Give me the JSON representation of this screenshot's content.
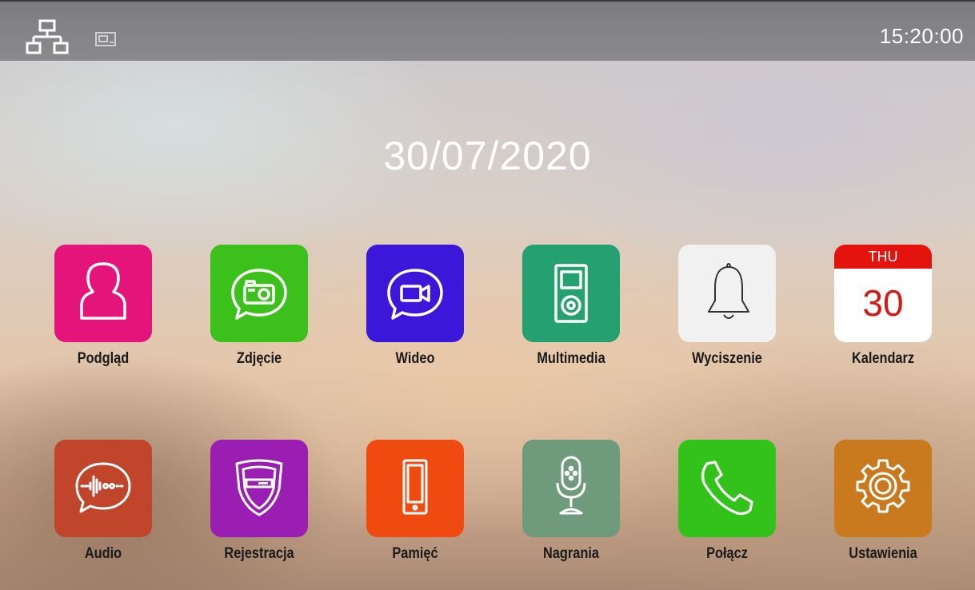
{
  "status_bar": {
    "time": "15:20:00",
    "icons": [
      "network-icon",
      "sd-card-icon"
    ]
  },
  "date": "30/07/2020",
  "apps": [
    {
      "label": "Podgląd",
      "icon": "person-icon",
      "color": "#e5147b"
    },
    {
      "label": "Zdjęcie",
      "icon": "camera-icon",
      "color": "#3cc01b"
    },
    {
      "label": "Wideo",
      "icon": "video-icon",
      "color": "#3a17d9"
    },
    {
      "label": "Multimedia",
      "icon": "media-player-icon",
      "color": "#24a071"
    },
    {
      "label": "Wyciszenie",
      "icon": "bell-icon",
      "color": "#f1f1f1"
    },
    {
      "label": "Kalendarz",
      "icon": "calendar-icon",
      "color": "#ffffff",
      "calendar": {
        "weekday": "THU",
        "day": "30"
      }
    },
    {
      "label": "Audio",
      "icon": "audio-wave-icon",
      "color": "#c0452a"
    },
    {
      "label": "Rejestracja",
      "icon": "shield-recorder-icon",
      "color": "#9b1eb3"
    },
    {
      "label": "Pamięć",
      "icon": "phone-memory-icon",
      "color": "#ef4a0f"
    },
    {
      "label": "Nagrania",
      "icon": "microphone-icon",
      "color": "#6f9a7c"
    },
    {
      "label": "Połącz",
      "icon": "phone-icon",
      "color": "#33c21a"
    },
    {
      "label": "Ustawienia",
      "icon": "gear-icon",
      "color": "#c97a1e"
    }
  ]
}
